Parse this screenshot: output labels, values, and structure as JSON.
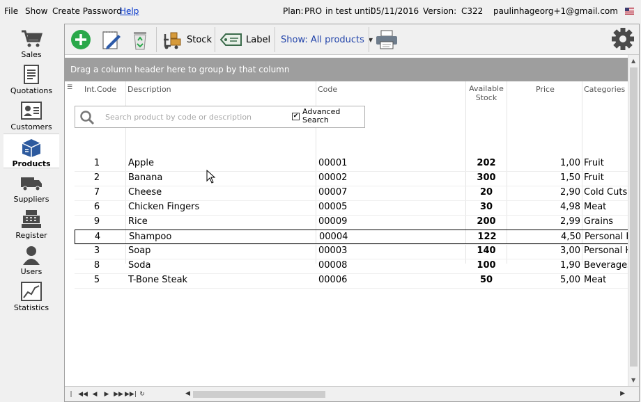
{
  "menu": {
    "file": "File",
    "show": "Show",
    "create_password": "Create Password",
    "help": "Help"
  },
  "status": {
    "plan_label": "Plan:",
    "plan_value": "PRO",
    "plan_trial": "in test until",
    "plan_date": "05/11/2016",
    "version_label": "Version:",
    "version_value": "C322",
    "user_email": "paulinhageorg+1@gmail.com"
  },
  "sidebar": {
    "items": [
      {
        "label": "Sales",
        "icon": "cart-icon"
      },
      {
        "label": "Quotations",
        "icon": "document-icon"
      },
      {
        "label": "Customers",
        "icon": "contact-card-icon"
      },
      {
        "label": "Products",
        "icon": "box-icon",
        "active": true
      },
      {
        "label": "Suppliers",
        "icon": "truck-icon"
      },
      {
        "label": "Register",
        "icon": "cash-register-icon"
      },
      {
        "label": "Users",
        "icon": "user-icon"
      },
      {
        "label": "Statistics",
        "icon": "chart-icon"
      }
    ]
  },
  "toolbar": {
    "stock_label": "Stock",
    "label_label": "Label",
    "show_filter": "Show: All products"
  },
  "grid": {
    "group_hint": "Drag a column header here to group by that column",
    "columns": {
      "id": "Int.Code",
      "description": "Description",
      "code": "Code",
      "stock": "Available Stock",
      "price": "Price",
      "categories": "Categories"
    },
    "search_placeholder": "Search product by code or description",
    "advanced_search": "Advanced Search",
    "rows": [
      {
        "id": "1",
        "description": "Apple",
        "code": "00001",
        "stock": "202",
        "price": "1,00",
        "category": "Fruit"
      },
      {
        "id": "2",
        "description": "Banana",
        "code": "00002",
        "stock": "300",
        "price": "1,50",
        "category": "Fruit"
      },
      {
        "id": "7",
        "description": "Cheese",
        "code": "00007",
        "stock": "20",
        "price": "2,90",
        "category": "Cold Cuts"
      },
      {
        "id": "6",
        "description": "Chicken Fingers",
        "code": "00005",
        "stock": "30",
        "price": "4,98",
        "category": "Meat"
      },
      {
        "id": "9",
        "description": "Rice",
        "code": "00009",
        "stock": "200",
        "price": "2,99",
        "category": "Grains"
      },
      {
        "id": "4",
        "description": "Shampoo",
        "code": "00004",
        "stock": "122",
        "price": "4,50",
        "category": "Personal H",
        "selected": true
      },
      {
        "id": "3",
        "description": "Soap",
        "code": "00003",
        "stock": "140",
        "price": "3,00",
        "category": "Personal H"
      },
      {
        "id": "8",
        "description": "Soda",
        "code": "00008",
        "stock": "100",
        "price": "1,90",
        "category": "Beverages"
      },
      {
        "id": "5",
        "description": "T-Bone Steak",
        "code": "00006",
        "stock": "50",
        "price": "5,00",
        "category": "Meat"
      }
    ]
  },
  "colors": {
    "accent_green": "#2aa84a",
    "link_blue": "#0033cc",
    "nav_icon": "#4a4a4a",
    "products_icon": "#2d5a9e"
  }
}
